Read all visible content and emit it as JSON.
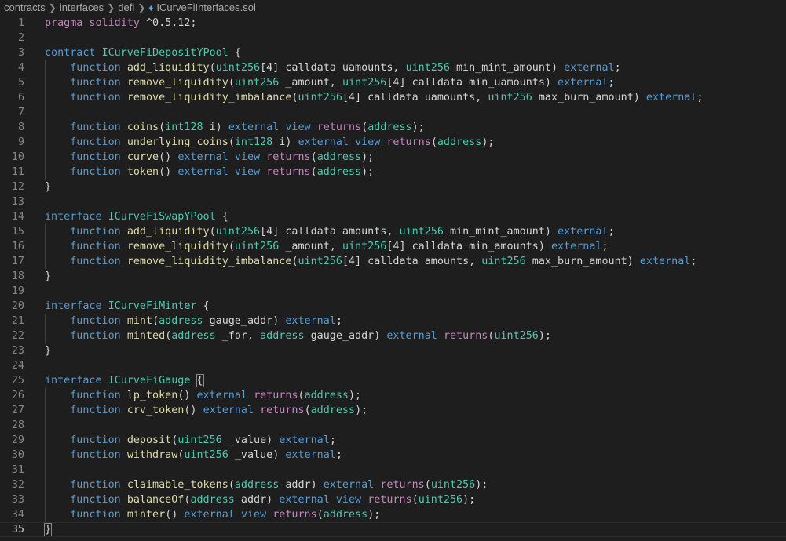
{
  "breadcrumb": {
    "items": [
      "contracts",
      "interfaces",
      "defi"
    ],
    "file_icon": "ethereum-icon",
    "file": "ICurveFiInterfaces.sol"
  },
  "lines": [
    [
      [
        "kw",
        "pragma"
      ],
      [
        "id",
        " "
      ],
      [
        "kw",
        "solidity"
      ],
      [
        "id",
        " ^0.5.12;"
      ]
    ],
    [],
    [
      [
        "kw2",
        "contract"
      ],
      [
        "id",
        " "
      ],
      [
        "ty",
        "ICurveFiDepositYPool"
      ],
      [
        "id",
        " {"
      ]
    ],
    [
      [
        "id",
        "    "
      ],
      [
        "kw2",
        "function"
      ],
      [
        "id",
        " "
      ],
      [
        "fn",
        "add_liquidity"
      ],
      [
        "id",
        "("
      ],
      [
        "ty",
        "uint256"
      ],
      [
        "id",
        "[4] calldata uamounts, "
      ],
      [
        "ty",
        "uint256"
      ],
      [
        "id",
        " min_mint_amount) "
      ],
      [
        "kw2",
        "external"
      ],
      [
        "id",
        ";"
      ]
    ],
    [
      [
        "id",
        "    "
      ],
      [
        "kw2",
        "function"
      ],
      [
        "id",
        " "
      ],
      [
        "fn",
        "remove_liquidity"
      ],
      [
        "id",
        "("
      ],
      [
        "ty",
        "uint256"
      ],
      [
        "id",
        " _amount, "
      ],
      [
        "ty",
        "uint256"
      ],
      [
        "id",
        "[4] calldata min_uamounts) "
      ],
      [
        "kw2",
        "external"
      ],
      [
        "id",
        ";"
      ]
    ],
    [
      [
        "id",
        "    "
      ],
      [
        "kw2",
        "function"
      ],
      [
        "id",
        " "
      ],
      [
        "fn",
        "remove_liquidity_imbalance"
      ],
      [
        "id",
        "("
      ],
      [
        "ty",
        "uint256"
      ],
      [
        "id",
        "[4] calldata uamounts, "
      ],
      [
        "ty",
        "uint256"
      ],
      [
        "id",
        " max_burn_amount) "
      ],
      [
        "kw2",
        "external"
      ],
      [
        "id",
        ";"
      ]
    ],
    [],
    [
      [
        "id",
        "    "
      ],
      [
        "kw2",
        "function"
      ],
      [
        "id",
        " "
      ],
      [
        "fn",
        "coins"
      ],
      [
        "id",
        "("
      ],
      [
        "ty",
        "int128"
      ],
      [
        "id",
        " i) "
      ],
      [
        "kw2",
        "external"
      ],
      [
        "id",
        " "
      ],
      [
        "kw2",
        "view"
      ],
      [
        "id",
        " "
      ],
      [
        "kw",
        "returns"
      ],
      [
        "id",
        "("
      ],
      [
        "ty",
        "address"
      ],
      [
        "id",
        ");"
      ]
    ],
    [
      [
        "id",
        "    "
      ],
      [
        "kw2",
        "function"
      ],
      [
        "id",
        " "
      ],
      [
        "fn",
        "underlying_coins"
      ],
      [
        "id",
        "("
      ],
      [
        "ty",
        "int128"
      ],
      [
        "id",
        " i) "
      ],
      [
        "kw2",
        "external"
      ],
      [
        "id",
        " "
      ],
      [
        "kw2",
        "view"
      ],
      [
        "id",
        " "
      ],
      [
        "kw",
        "returns"
      ],
      [
        "id",
        "("
      ],
      [
        "ty",
        "address"
      ],
      [
        "id",
        ");"
      ]
    ],
    [
      [
        "id",
        "    "
      ],
      [
        "kw2",
        "function"
      ],
      [
        "id",
        " "
      ],
      [
        "fn",
        "curve"
      ],
      [
        "id",
        "() "
      ],
      [
        "kw2",
        "external"
      ],
      [
        "id",
        " "
      ],
      [
        "kw2",
        "view"
      ],
      [
        "id",
        " "
      ],
      [
        "kw",
        "returns"
      ],
      [
        "id",
        "("
      ],
      [
        "ty",
        "address"
      ],
      [
        "id",
        ");"
      ]
    ],
    [
      [
        "id",
        "    "
      ],
      [
        "kw2",
        "function"
      ],
      [
        "id",
        " "
      ],
      [
        "fn",
        "token"
      ],
      [
        "id",
        "() "
      ],
      [
        "kw2",
        "external"
      ],
      [
        "id",
        " "
      ],
      [
        "kw2",
        "view"
      ],
      [
        "id",
        " "
      ],
      [
        "kw",
        "returns"
      ],
      [
        "id",
        "("
      ],
      [
        "ty",
        "address"
      ],
      [
        "id",
        ");"
      ]
    ],
    [
      [
        "id",
        "}"
      ]
    ],
    [],
    [
      [
        "kw2",
        "interface"
      ],
      [
        "id",
        " "
      ],
      [
        "ty",
        "ICurveFiSwapYPool"
      ],
      [
        "id",
        " {"
      ]
    ],
    [
      [
        "id",
        "    "
      ],
      [
        "kw2",
        "function"
      ],
      [
        "id",
        " "
      ],
      [
        "fn",
        "add_liquidity"
      ],
      [
        "id",
        "("
      ],
      [
        "ty",
        "uint256"
      ],
      [
        "id",
        "[4] calldata amounts, "
      ],
      [
        "ty",
        "uint256"
      ],
      [
        "id",
        " min_mint_amount) "
      ],
      [
        "kw2",
        "external"
      ],
      [
        "id",
        ";"
      ]
    ],
    [
      [
        "id",
        "    "
      ],
      [
        "kw2",
        "function"
      ],
      [
        "id",
        " "
      ],
      [
        "fn",
        "remove_liquidity"
      ],
      [
        "id",
        "("
      ],
      [
        "ty",
        "uint256"
      ],
      [
        "id",
        " _amount, "
      ],
      [
        "ty",
        "uint256"
      ],
      [
        "id",
        "[4] calldata min_amounts) "
      ],
      [
        "kw2",
        "external"
      ],
      [
        "id",
        ";"
      ]
    ],
    [
      [
        "id",
        "    "
      ],
      [
        "kw2",
        "function"
      ],
      [
        "id",
        " "
      ],
      [
        "fn",
        "remove_liquidity_imbalance"
      ],
      [
        "id",
        "("
      ],
      [
        "ty",
        "uint256"
      ],
      [
        "id",
        "[4] calldata amounts, "
      ],
      [
        "ty",
        "uint256"
      ],
      [
        "id",
        " max_burn_amount) "
      ],
      [
        "kw2",
        "external"
      ],
      [
        "id",
        ";"
      ]
    ],
    [
      [
        "id",
        "}"
      ]
    ],
    [],
    [
      [
        "kw2",
        "interface"
      ],
      [
        "id",
        " "
      ],
      [
        "ty",
        "ICurveFiMinter"
      ],
      [
        "id",
        " {"
      ]
    ],
    [
      [
        "id",
        "    "
      ],
      [
        "kw2",
        "function"
      ],
      [
        "id",
        " "
      ],
      [
        "fn",
        "mint"
      ],
      [
        "id",
        "("
      ],
      [
        "ty",
        "address"
      ],
      [
        "id",
        " gauge_addr) "
      ],
      [
        "kw2",
        "external"
      ],
      [
        "id",
        ";"
      ]
    ],
    [
      [
        "id",
        "    "
      ],
      [
        "kw2",
        "function"
      ],
      [
        "id",
        " "
      ],
      [
        "fn",
        "minted"
      ],
      [
        "id",
        "("
      ],
      [
        "ty",
        "address"
      ],
      [
        "id",
        " _for, "
      ],
      [
        "ty",
        "address"
      ],
      [
        "id",
        " gauge_addr) "
      ],
      [
        "kw2",
        "external"
      ],
      [
        "id",
        " "
      ],
      [
        "kw",
        "returns"
      ],
      [
        "id",
        "("
      ],
      [
        "ty",
        "uint256"
      ],
      [
        "id",
        ");"
      ]
    ],
    [
      [
        "id",
        "}"
      ]
    ],
    [],
    [
      [
        "kw2",
        "interface"
      ],
      [
        "id",
        " "
      ],
      [
        "ty",
        "ICurveFiGauge"
      ],
      [
        "id",
        " "
      ],
      [
        "br",
        "{"
      ]
    ],
    [
      [
        "id",
        "    "
      ],
      [
        "kw2",
        "function"
      ],
      [
        "id",
        " "
      ],
      [
        "fn",
        "lp_token"
      ],
      [
        "id",
        "() "
      ],
      [
        "kw2",
        "external"
      ],
      [
        "id",
        " "
      ],
      [
        "kw",
        "returns"
      ],
      [
        "id",
        "("
      ],
      [
        "ty",
        "address"
      ],
      [
        "id",
        ");"
      ]
    ],
    [
      [
        "id",
        "    "
      ],
      [
        "kw2",
        "function"
      ],
      [
        "id",
        " "
      ],
      [
        "fn",
        "crv_token"
      ],
      [
        "id",
        "() "
      ],
      [
        "kw2",
        "external"
      ],
      [
        "id",
        " "
      ],
      [
        "kw",
        "returns"
      ],
      [
        "id",
        "("
      ],
      [
        "ty",
        "address"
      ],
      [
        "id",
        ");"
      ]
    ],
    [],
    [
      [
        "id",
        "    "
      ],
      [
        "kw2",
        "function"
      ],
      [
        "id",
        " "
      ],
      [
        "fn",
        "deposit"
      ],
      [
        "id",
        "("
      ],
      [
        "ty",
        "uint256"
      ],
      [
        "id",
        " _value) "
      ],
      [
        "kw2",
        "external"
      ],
      [
        "id",
        ";"
      ]
    ],
    [
      [
        "id",
        "    "
      ],
      [
        "kw2",
        "function"
      ],
      [
        "id",
        " "
      ],
      [
        "fn",
        "withdraw"
      ],
      [
        "id",
        "("
      ],
      [
        "ty",
        "uint256"
      ],
      [
        "id",
        " _value) "
      ],
      [
        "kw2",
        "external"
      ],
      [
        "id",
        ";"
      ]
    ],
    [],
    [
      [
        "id",
        "    "
      ],
      [
        "kw2",
        "function"
      ],
      [
        "id",
        " "
      ],
      [
        "fn",
        "claimable_tokens"
      ],
      [
        "id",
        "("
      ],
      [
        "ty",
        "address"
      ],
      [
        "id",
        " addr) "
      ],
      [
        "kw2",
        "external"
      ],
      [
        "id",
        " "
      ],
      [
        "kw",
        "returns"
      ],
      [
        "id",
        "("
      ],
      [
        "ty",
        "uint256"
      ],
      [
        "id",
        ");"
      ]
    ],
    [
      [
        "id",
        "    "
      ],
      [
        "kw2",
        "function"
      ],
      [
        "id",
        " "
      ],
      [
        "fn",
        "balanceOf"
      ],
      [
        "id",
        "("
      ],
      [
        "ty",
        "address"
      ],
      [
        "id",
        " addr) "
      ],
      [
        "kw2",
        "external"
      ],
      [
        "id",
        " "
      ],
      [
        "kw2",
        "view"
      ],
      [
        "id",
        " "
      ],
      [
        "kw",
        "returns"
      ],
      [
        "id",
        "("
      ],
      [
        "ty",
        "uint256"
      ],
      [
        "id",
        ");"
      ]
    ],
    [
      [
        "id",
        "    "
      ],
      [
        "kw2",
        "function"
      ],
      [
        "id",
        " "
      ],
      [
        "fn",
        "minter"
      ],
      [
        "id",
        "() "
      ],
      [
        "kw2",
        "external"
      ],
      [
        "id",
        " "
      ],
      [
        "kw2",
        "view"
      ],
      [
        "id",
        " "
      ],
      [
        "kw",
        "returns"
      ],
      [
        "id",
        "("
      ],
      [
        "ty",
        "address"
      ],
      [
        "id",
        ");"
      ]
    ],
    [
      [
        "br",
        "}"
      ]
    ]
  ],
  "current_line": 35
}
